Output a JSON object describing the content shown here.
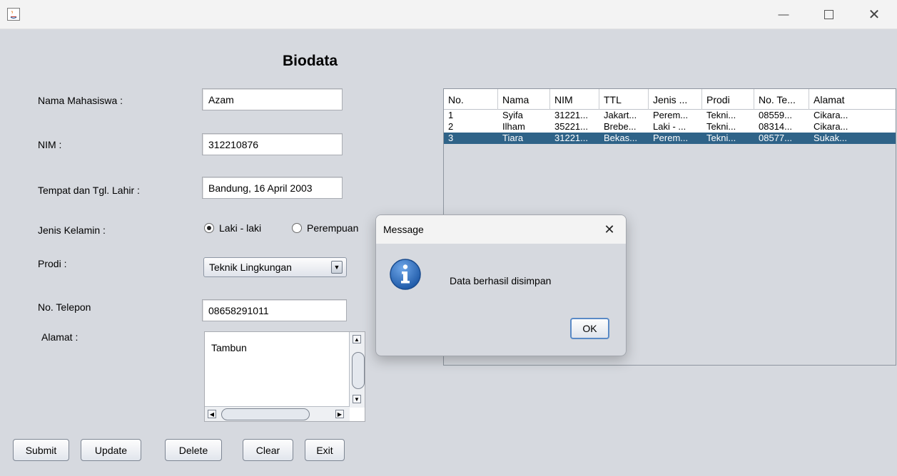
{
  "window": {
    "minimize_icon": "minimize-icon",
    "maximize_icon": "maximize-icon",
    "close_icon": "close-icon"
  },
  "form": {
    "heading": "Biodata",
    "labels": {
      "nama": "Nama Mahasiswa :",
      "nim": "NIM :",
      "ttl": "Tempat dan Tgl. Lahir :",
      "jenis_kelamin": "Jenis Kelamin :",
      "prodi": "Prodi :",
      "telepon": "No. Telepon",
      "alamat": "Alamat :"
    },
    "values": {
      "nama": "Azam",
      "nim": "312210876",
      "ttl": "Bandung, 16 April 2003",
      "prodi": "Teknik Lingkungan",
      "telepon": "08658291011",
      "alamat": "Tambun"
    },
    "gender_options": [
      "Laki - laki",
      "Perempuan"
    ],
    "gender_selected": "Laki - laki"
  },
  "buttons": {
    "submit": "Submit",
    "update": "Update",
    "delete": "Delete",
    "clear": "Clear",
    "exit": "Exit"
  },
  "table": {
    "columns": [
      "No.",
      "Nama",
      "NIM",
      "TTL",
      "Jenis ...",
      "Prodi",
      "No. Te...",
      "Alamat"
    ],
    "rows": [
      [
        "1",
        "Syifa",
        "31221...",
        "Jakart...",
        "Perem...",
        "Tekni...",
        "08559...",
        "Cikara..."
      ],
      [
        "2",
        "Ilham",
        "35221...",
        "Brebe...",
        "Laki - ...",
        "Tekni...",
        "08314...",
        "Cikara..."
      ],
      [
        "3",
        "Tiara",
        "31221...",
        "Bekas...",
        "Perem...",
        "Tekni...",
        "08577...",
        "Sukak..."
      ]
    ],
    "selected_row": 3,
    "selection_color": "#2f6388"
  },
  "dialog": {
    "title": "Message",
    "message": "Data berhasil disimpan",
    "ok_label": "OK",
    "icon": "info-icon"
  }
}
